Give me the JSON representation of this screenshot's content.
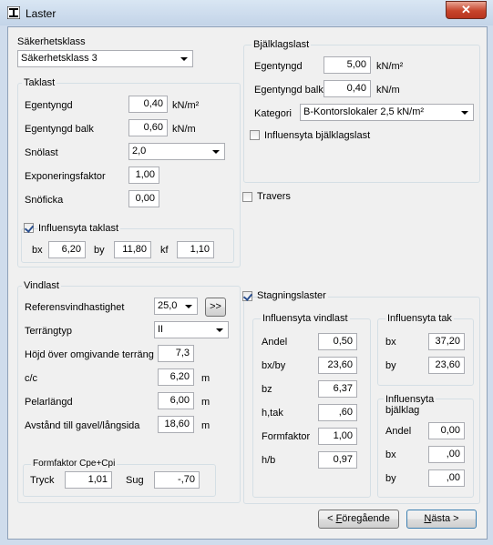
{
  "window": {
    "title": "Laster",
    "close": "✕"
  },
  "sakerhetsklass": {
    "title": "Säkerhetsklass",
    "value": "Säkerhetsklass 3"
  },
  "taklast": {
    "title": "Taklast",
    "egentyngd": {
      "label": "Egentyngd",
      "value": "0,40",
      "unit": "kN/m²"
    },
    "egentyngd_balk": {
      "label": "Egentyngd balk",
      "value": "0,60",
      "unit": "kN/m"
    },
    "snolast": {
      "label": "Snölast",
      "value": "2,0"
    },
    "exponeringsfaktor": {
      "label": "Exponeringsfaktor",
      "value": "1,00"
    },
    "snoficka": {
      "label": "Snöficka",
      "value": "0,00"
    },
    "influensyta": {
      "label": "Influensyta taklast",
      "checked": true,
      "bx_label": "bx",
      "bx": "6,20",
      "by_label": "by",
      "by": "11,80",
      "kf_label": "kf",
      "kf": "1,10"
    }
  },
  "bjalklagslast": {
    "title": "Bjälklagslast",
    "egentyngd": {
      "label": "Egentyngd",
      "value": "5,00",
      "unit": "kN/m²"
    },
    "egentyngd_balk": {
      "label": "Egentyngd balk",
      "value": "0,40",
      "unit": "kN/m"
    },
    "kategori": {
      "label": "Kategori",
      "value": "B-Kontorslokaler 2,5 kN/m²"
    },
    "influensyta": {
      "label": "Influensyta bjälklagslast",
      "checked": false
    }
  },
  "travers": {
    "label": "Travers",
    "checked": false
  },
  "vindlast": {
    "title": "Vindlast",
    "referens": {
      "label": "Referensvindhastighet",
      "value": "25,0",
      "button": ">>"
    },
    "terrangtyp": {
      "label": "Terrängtyp",
      "value": "II"
    },
    "hojd": {
      "label": "Höjd över omgivande terräng",
      "value": "7,3"
    },
    "cc": {
      "label": "c/c",
      "value": "6,20",
      "unit": "m"
    },
    "pelarlangd": {
      "label": "Pelarlängd",
      "value": "6,00",
      "unit": "m"
    },
    "avstand": {
      "label": "Avstånd till gavel/långsida",
      "value": "18,60",
      "unit": "m"
    },
    "formfaktor": {
      "title": "Formfaktor Cpe+Cpi",
      "tryck_label": "Tryck",
      "tryck": "1,01",
      "sug_label": "Sug",
      "sug": "-,70"
    }
  },
  "stagning": {
    "label": "Stagningslaster",
    "checked": true,
    "vind": {
      "title": "Influensyta vindlast",
      "andel": {
        "label": "Andel",
        "value": "0,50"
      },
      "bxby": {
        "label": "bx/by",
        "value": "23,60"
      },
      "bz": {
        "label": "bz",
        "value": "6,37"
      },
      "htak": {
        "label": "h,tak",
        "value": ",60"
      },
      "formfaktor": {
        "label": "Formfaktor",
        "value": "1,00"
      },
      "hb": {
        "label": "h/b",
        "value": "0,97"
      }
    },
    "tak": {
      "title": "Influensyta tak",
      "bx": {
        "label": "bx",
        "value": "37,20"
      },
      "by": {
        "label": "by",
        "value": "23,60"
      }
    },
    "bjalklag": {
      "title_line1": "Influensyta",
      "title_line2": "bjälklag",
      "andel": {
        "label": "Andel",
        "value": "0,00"
      },
      "bx": {
        "label": "bx",
        "value": ",00"
      },
      "by": {
        "label": "by",
        "value": ",00"
      }
    }
  },
  "buttons": {
    "prev_arrow": "< ",
    "prev_hot": "F",
    "prev_rest": "öregående",
    "next_hot": "N",
    "next_rest": "ästa >"
  }
}
